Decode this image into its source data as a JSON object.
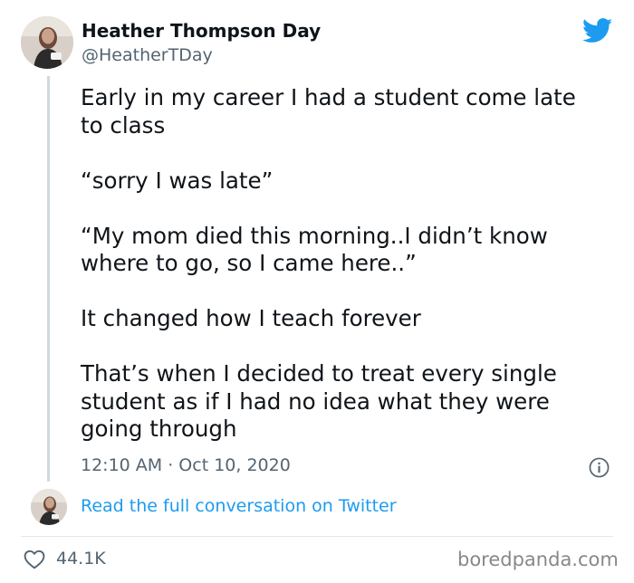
{
  "tweet": {
    "author_name": "Heather Thompson Day",
    "author_handle": "@HeatherTDay",
    "text": "Early in my career I had a student come late\nto class\n\n“sorry I was late”\n\n“My mom died this morning..I didn’t know\nwhere to go, so I came here..”\n\nIt changed how I teach forever\n\nThat’s when I decided to treat every single\nstudent as if I had no idea what they were\ngoing through",
    "timestamp": "12:10 AM · Oct 10, 2020",
    "full_conversation_label": "Read the full conversation on Twitter",
    "like_count": "44.1K"
  },
  "icons": {
    "brand": "twitter-bird-icon",
    "info": "info-icon",
    "like": "heart-icon"
  },
  "colors": {
    "twitter_blue": "#1d9bf0",
    "text_primary": "#0f1419",
    "text_secondary": "#536471",
    "thread_line": "#cfd9de"
  },
  "watermark": "boredpanda.com"
}
